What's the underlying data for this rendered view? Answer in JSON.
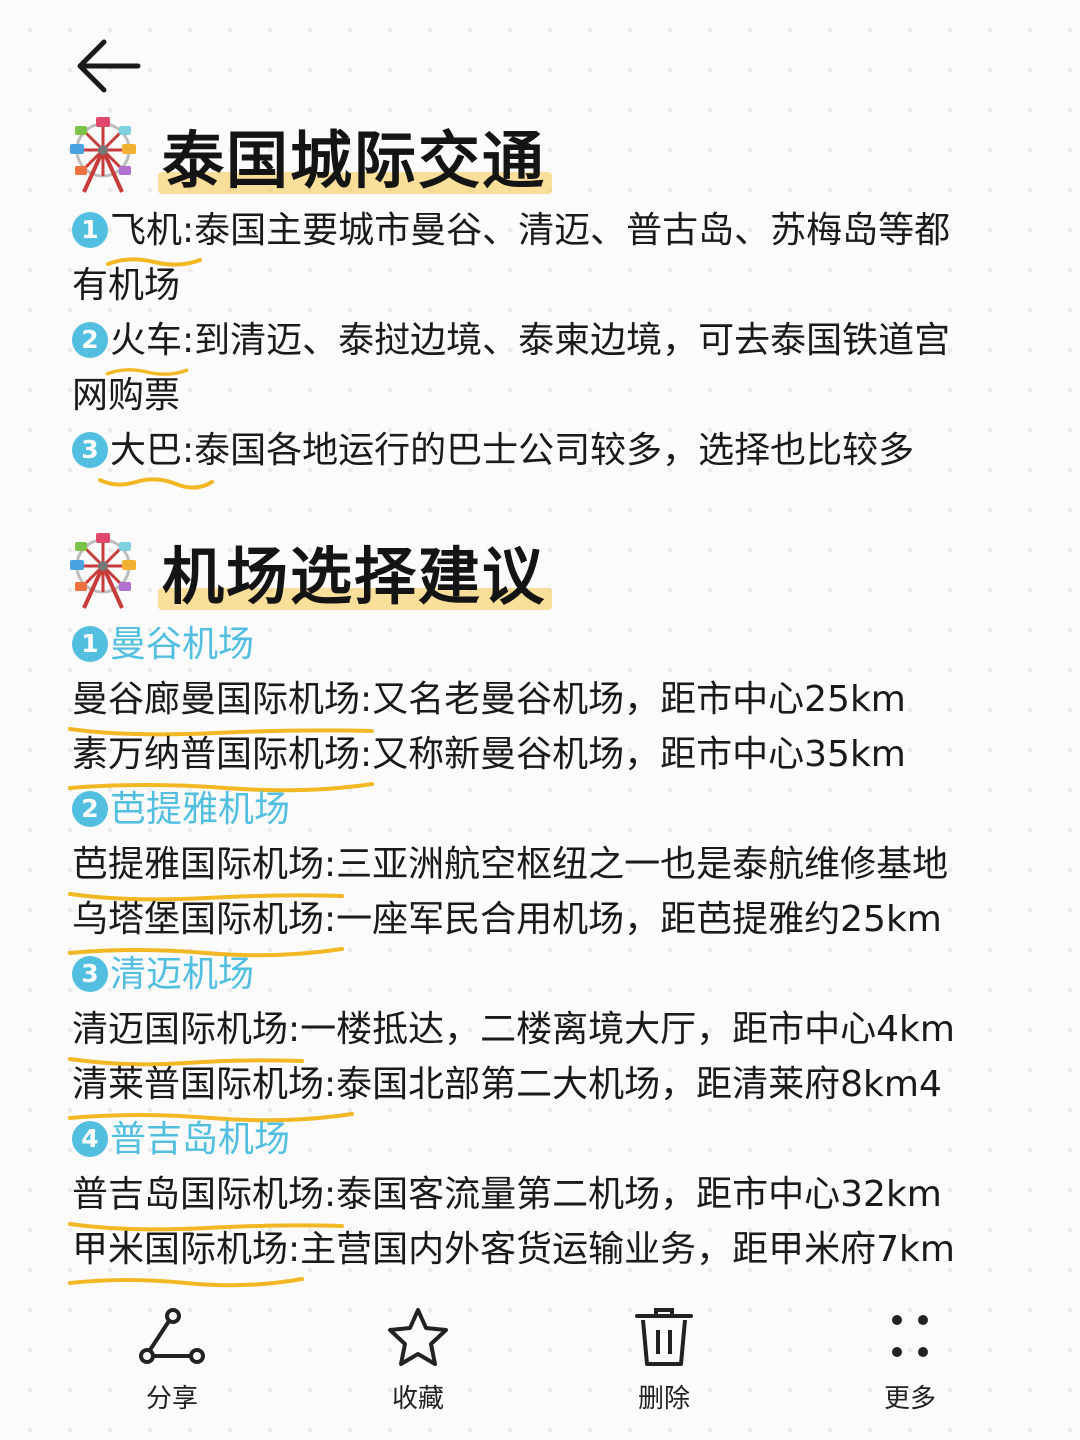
{
  "sections": [
    {
      "title": "泰国城际交通",
      "items": [
        {
          "num": "1",
          "key": "飞机",
          "rest": ":泰国主要城市曼谷、清迈、普古岛、苏梅岛等都",
          "rest2": "有机场"
        },
        {
          "num": "2",
          "key": "火车",
          "rest": ":到清迈、泰挝边境、泰柬边境，可去泰国铁道宫",
          "rest2": "网购票"
        },
        {
          "num": "3",
          "key": "大巴",
          "rest": ":泰国各地运行的巴士公司较多，选择也比较多",
          "rest2": ""
        }
      ]
    },
    {
      "title": "机场选择建议",
      "groups": [
        {
          "num": "1",
          "name": "曼谷机场",
          "lines": [
            {
              "key": "曼谷廊曼国际机场",
              "rest": ":又名老曼谷机场，距市中心25km"
            },
            {
              "key": "素万纳普国际机场",
              "rest": ":又称新曼谷机场，距市中心35km"
            }
          ]
        },
        {
          "num": "2",
          "name": "芭提雅机场",
          "lines": [
            {
              "key": "芭提雅国际机场",
              "rest": ":三亚洲航空枢纽之一也是泰航维修基地"
            },
            {
              "key": "乌塔堡国际机场",
              "rest": ":一座军民合用机场，距芭提雅约25km"
            }
          ]
        },
        {
          "num": "3",
          "name": "清迈机场",
          "lines": [
            {
              "key": "清迈国际机场",
              "rest": ":一楼抵达，二楼离境大厅，距市中心4km"
            },
            {
              "key": "清莱普国际机场",
              "rest": ":泰国北部第二大机场，距清莱府8km4"
            }
          ]
        },
        {
          "num": "4",
          "name": "普吉岛机场",
          "lines": [
            {
              "key": "普吉岛国际机场",
              "rest": ":泰国客流量第二机场，距市中心32km"
            },
            {
              "key": "甲米国际机场",
              "rest": ":主营国内外客货运输业务，距甲米府7km"
            }
          ]
        }
      ]
    }
  ],
  "toolbar": {
    "share": "分享",
    "favorite": "收藏",
    "delete": "删除",
    "more": "更多"
  },
  "colors": {
    "accent": "#52bfe0",
    "underline": "#f2b824",
    "highlight": "#f7c948"
  },
  "icons": [
    "back-arrow-icon",
    "ferris-wheel-icon",
    "share-icon",
    "star-icon",
    "trash-icon",
    "more-icon"
  ]
}
